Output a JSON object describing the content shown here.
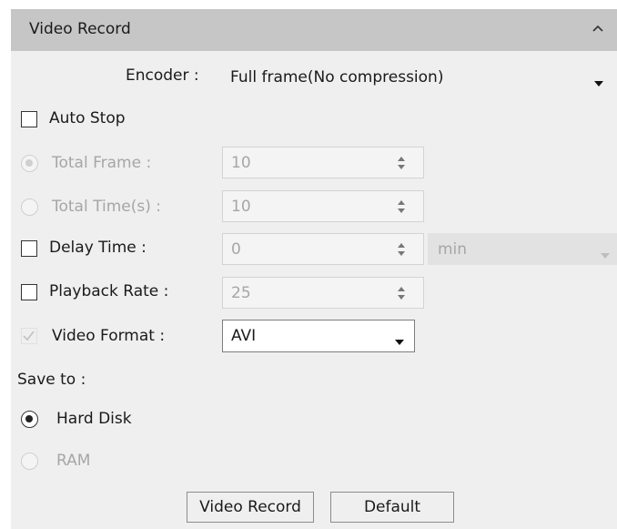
{
  "panel": {
    "title": "Video Record"
  },
  "encoder": {
    "label": "Encoder :",
    "value": "Full frame(No compression)"
  },
  "auto_stop": {
    "label": "Auto Stop",
    "checked": false
  },
  "total_frame": {
    "label": "Total Frame  :",
    "value": "10"
  },
  "total_time": {
    "label": "Total Time(s) :",
    "value": "10"
  },
  "delay_time": {
    "label": "Delay Time :",
    "value": "0",
    "unit": "min",
    "checked": false
  },
  "playback_rate": {
    "label": "Playback Rate :",
    "value": "25",
    "checked": false
  },
  "video_format": {
    "label": "Video Format :",
    "value": "AVI",
    "checked": true
  },
  "save_to": {
    "label": "Save to :",
    "options": [
      {
        "label": "Hard Disk",
        "selected": true
      },
      {
        "label": "RAM",
        "selected": false
      }
    ]
  },
  "buttons": {
    "record_label": "Video Record",
    "default_label": "Default"
  }
}
